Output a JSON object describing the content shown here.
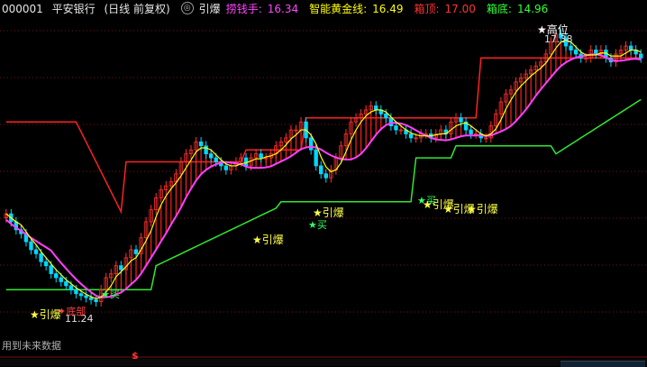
{
  "header": {
    "code": "000001",
    "name": "平安银行",
    "period": "(日线 前复权)",
    "indicator": "引爆",
    "items": [
      {
        "label": "捞钱手:",
        "value": "16.34",
        "color": "#ff44ff"
      },
      {
        "label": "智能黄金线:",
        "value": "16.49",
        "color": "#ffff00"
      },
      {
        "label": "箱顶:",
        "value": "17.00",
        "color": "#ff3333"
      },
      {
        "label": "箱底:",
        "value": "14.96",
        "color": "#33ff33"
      }
    ]
  },
  "annotations": {
    "high_label": "高位",
    "high_price": "17.38",
    "low_price": "11.24",
    "bottom_label": "底部",
    "buy": "买",
    "burst": "引爆"
  },
  "footer": {
    "notice": "用到未来数据",
    "marker": "$"
  },
  "colors": {
    "up": "#ff3030",
    "down": "#00d8ff",
    "box_top": "#ff2020",
    "box_bottom": "#30e830",
    "gold": "#ffff00",
    "money": "#ff40ff"
  },
  "chart_data": {
    "type": "candlestick",
    "y_range": [
      10.5,
      18.4
    ],
    "closes": [
      13.5,
      13.3,
      13.1,
      13.0,
      12.8,
      12.6,
      12.5,
      12.3,
      12.2,
      12.0,
      11.9,
      11.8,
      11.7,
      11.6,
      11.5,
      11.45,
      11.4,
      11.35,
      11.3,
      11.6,
      11.9,
      12.0,
      12.2,
      12.1,
      12.4,
      12.6,
      12.5,
      12.9,
      13.3,
      13.6,
      13.9,
      14.1,
      14.2,
      14.3,
      14.5,
      14.8,
      15.0,
      15.1,
      15.3,
      15.2,
      15.0,
      14.9,
      14.8,
      14.7,
      14.6,
      14.7,
      14.8,
      14.9,
      14.7,
      14.9,
      15.0,
      14.9,
      14.9,
      15.0,
      15.2,
      15.3,
      15.4,
      15.6,
      15.6,
      15.8,
      15.4,
      15.1,
      14.7,
      14.5,
      14.4,
      14.6,
      14.9,
      15.2,
      15.5,
      15.8,
      15.9,
      16.0,
      16.1,
      16.2,
      16.1,
      16.0,
      15.9,
      15.7,
      15.6,
      15.6,
      15.5,
      15.4,
      15.4,
      15.5,
      15.5,
      15.4,
      15.5,
      15.6,
      15.5,
      15.8,
      15.9,
      15.8,
      15.6,
      15.5,
      15.5,
      15.4,
      15.4,
      15.7,
      16.0,
      16.3,
      16.5,
      16.6,
      16.8,
      16.9,
      17.0,
      17.1,
      17.2,
      17.3,
      17.5,
      17.8,
      18.0,
      17.9,
      17.7,
      17.6,
      17.5,
      17.4,
      17.4,
      17.6,
      17.5,
      17.6,
      17.4,
      17.3,
      17.5,
      17.6,
      17.7,
      17.6,
      17.5,
      17.4
    ]
  }
}
